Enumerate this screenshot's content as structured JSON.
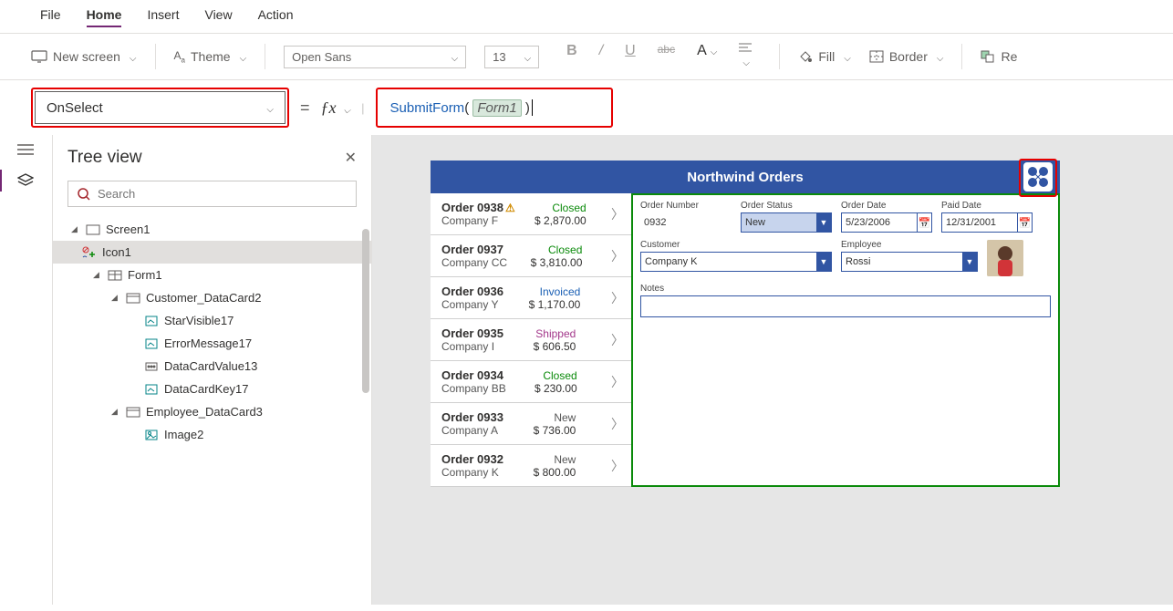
{
  "menu": {
    "file": "File",
    "home": "Home",
    "insert": "Insert",
    "view": "View",
    "action": "Action"
  },
  "toolbar": {
    "new_screen": "New screen",
    "theme": "Theme",
    "font": "Open Sans",
    "size": "13",
    "fill": "Fill",
    "border": "Border",
    "reorder": "Re"
  },
  "property": {
    "name": "OnSelect"
  },
  "formula": {
    "fn": "SubmitForm",
    "arg": "Form1"
  },
  "treeview": {
    "title": "Tree view",
    "search_ph": "Search",
    "screen1": "Screen1",
    "icon1": "Icon1",
    "form1": "Form1",
    "cust_card": "Customer_DataCard2",
    "star": "StarVisible17",
    "err": "ErrorMessage17",
    "dcv": "DataCardValue13",
    "dck": "DataCardKey17",
    "emp_card": "Employee_DataCard3",
    "img": "Image2"
  },
  "app": {
    "title": "Northwind Orders"
  },
  "orders": [
    {
      "num": "Order 0938",
      "company": "Company F",
      "status": "Closed",
      "status_cls": "closed",
      "amount": "$ 2,870.00",
      "warn": true
    },
    {
      "num": "Order 0937",
      "company": "Company CC",
      "status": "Closed",
      "status_cls": "closed",
      "amount": "$ 3,810.00"
    },
    {
      "num": "Order 0936",
      "company": "Company Y",
      "status": "Invoiced",
      "status_cls": "invoiced",
      "amount": "$ 1,170.00"
    },
    {
      "num": "Order 0935",
      "company": "Company I",
      "status": "Shipped",
      "status_cls": "shipped",
      "amount": "$ 606.50"
    },
    {
      "num": "Order 0934",
      "company": "Company BB",
      "status": "Closed",
      "status_cls": "closed",
      "amount": "$ 230.00"
    },
    {
      "num": "Order 0933",
      "company": "Company A",
      "status": "New",
      "status_cls": "new",
      "amount": "$ 736.00"
    },
    {
      "num": "Order 0932",
      "company": "Company K",
      "status": "New",
      "status_cls": "new",
      "amount": "$ 800.00"
    }
  ],
  "detail": {
    "ordnum_lbl": "Order Number",
    "ordnum": "0932",
    "status_lbl": "Order Status",
    "status": "New",
    "orddate_lbl": "Order Date",
    "orddate": "5/23/2006",
    "paiddate_lbl": "Paid Date",
    "paiddate": "12/31/2001",
    "cust_lbl": "Customer",
    "cust": "Company K",
    "emp_lbl": "Employee",
    "emp": "Rossi",
    "notes_lbl": "Notes"
  }
}
